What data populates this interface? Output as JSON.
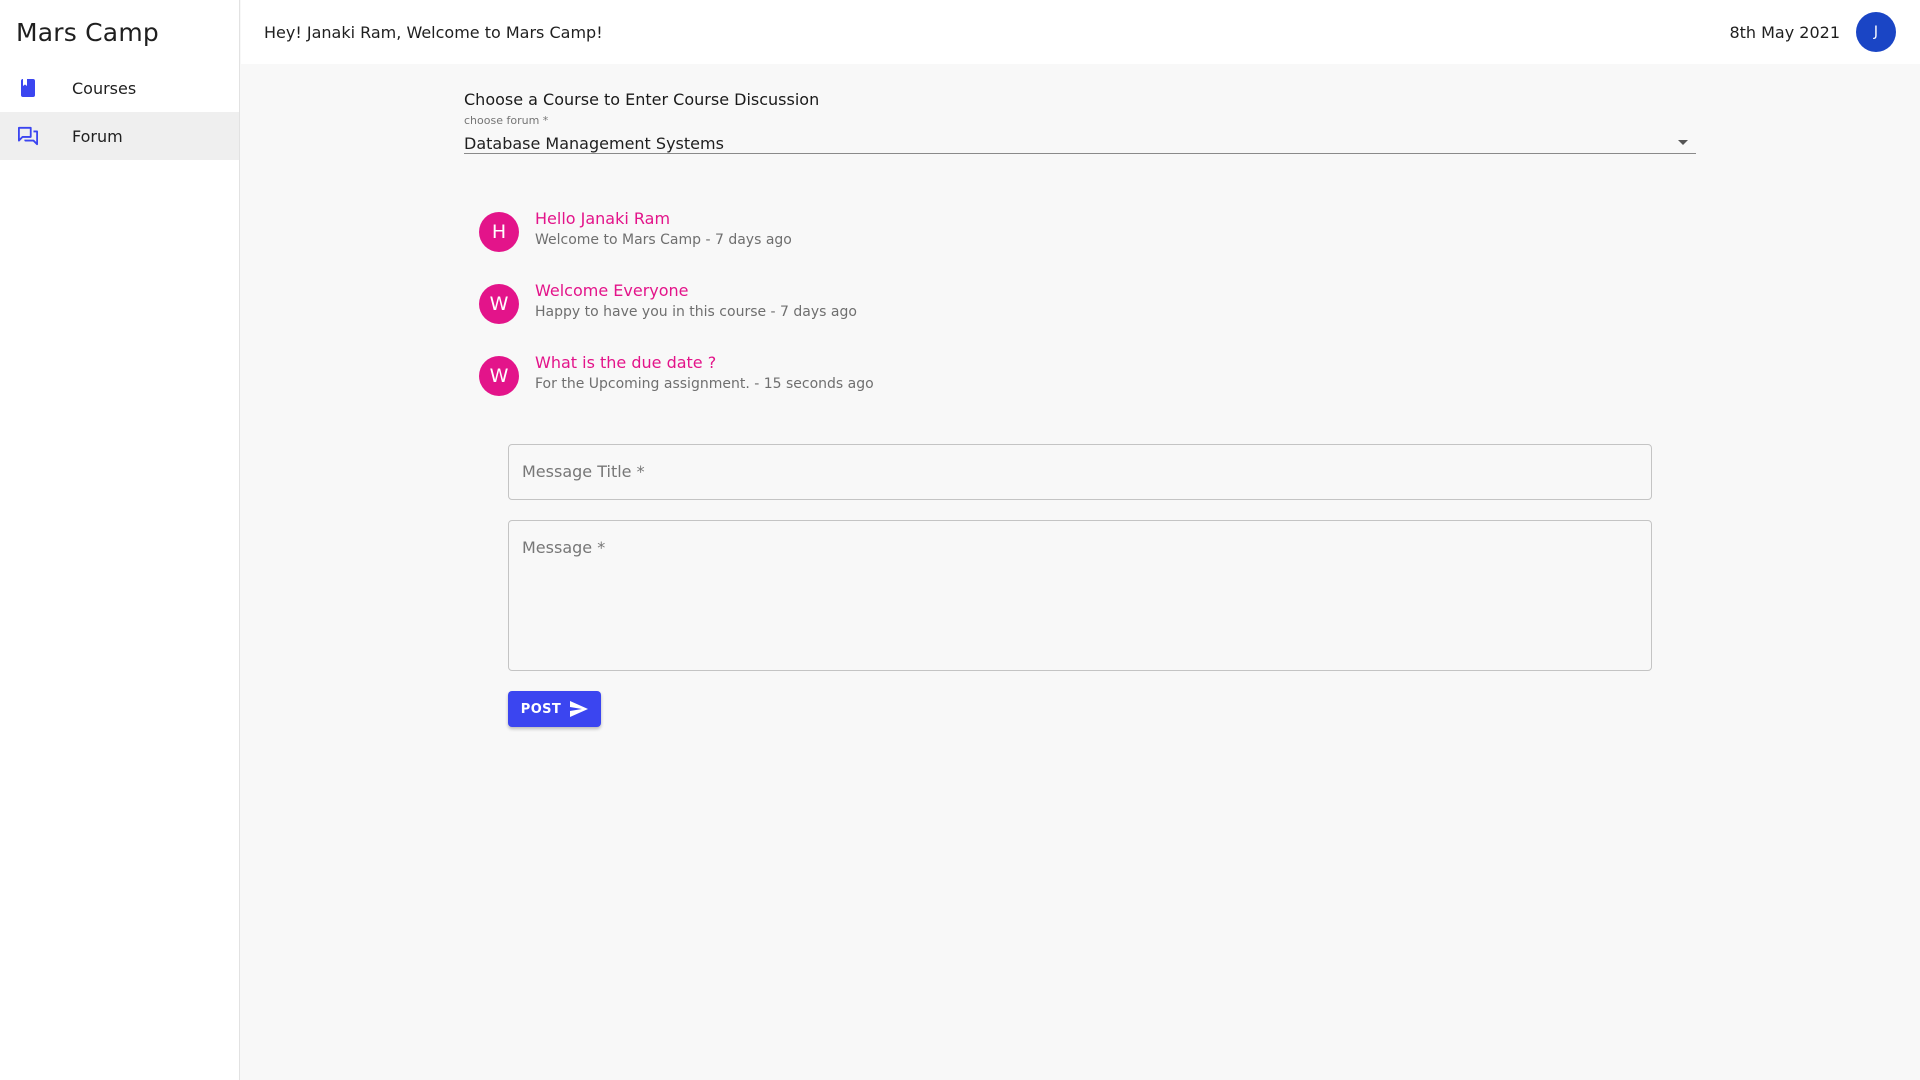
{
  "app": {
    "title": "Mars Camp"
  },
  "sidebar": {
    "items": [
      {
        "label": "Courses",
        "icon": "book-icon",
        "active": false
      },
      {
        "label": "Forum",
        "icon": "forum-icon",
        "active": true
      }
    ]
  },
  "header": {
    "greeting": "Hey! Janaki Ram, Welcome to Mars Camp!",
    "date": "8th May 2021",
    "avatar_initial": "J"
  },
  "main": {
    "section_title": "Choose a Course to Enter Course Discussion",
    "forum_select": {
      "label": "choose forum *",
      "value": "Database Management Systems"
    },
    "messages": [
      {
        "initial": "H",
        "title": "Hello Janaki Ram",
        "subtitle": "Welcome to Mars Camp - 7 days ago"
      },
      {
        "initial": "W",
        "title": "Welcome Everyone",
        "subtitle": "Happy to have you in this course - 7 days ago"
      },
      {
        "initial": "W",
        "title": "What is the due date ?",
        "subtitle": "For the Upcoming assignment. - 15 seconds ago"
      }
    ],
    "form": {
      "title_placeholder": "Message Title *",
      "message_placeholder": "Message *",
      "post_label": "POST"
    }
  },
  "colors": {
    "accent": "#3b45f0",
    "avatar_user": "#1a45c5",
    "message_pink": "#e3148a"
  }
}
